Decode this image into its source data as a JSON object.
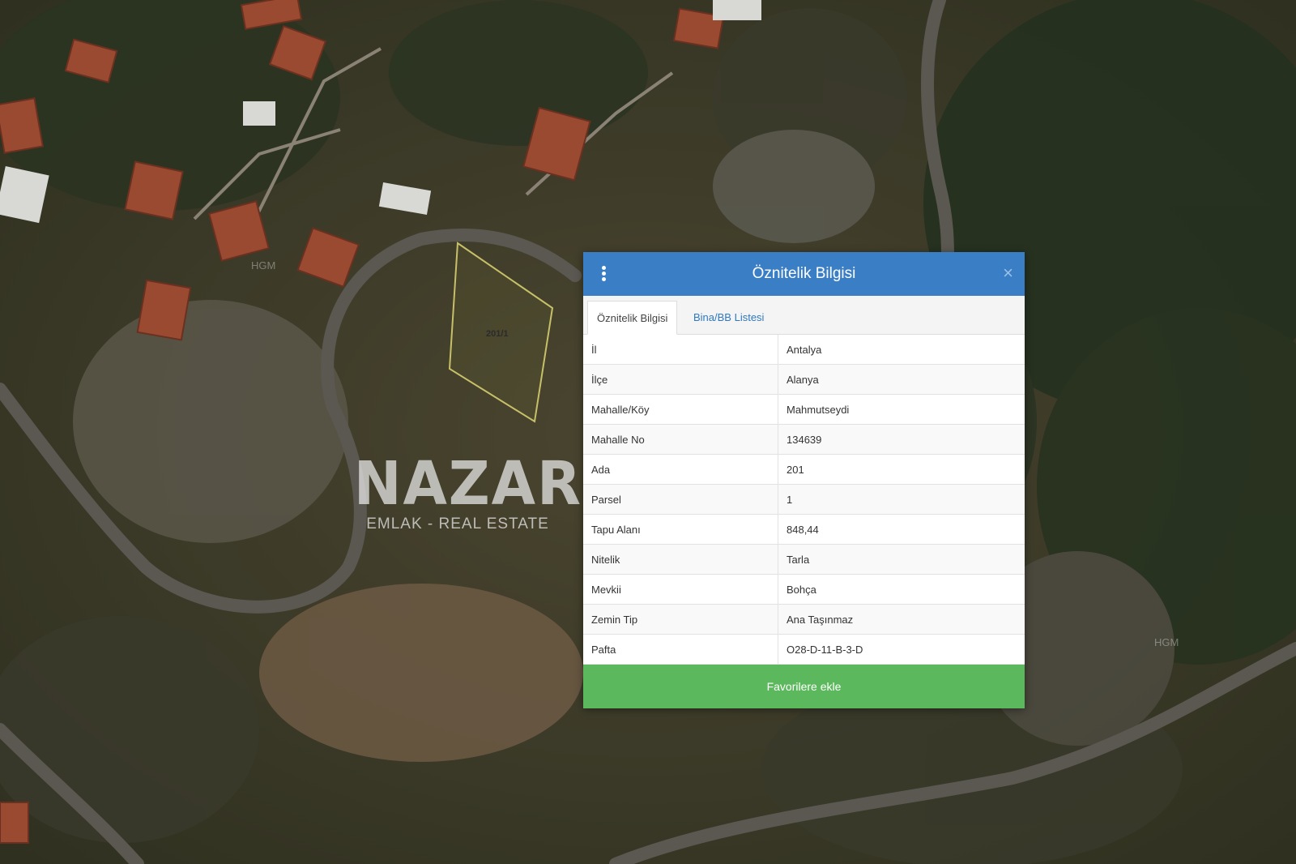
{
  "map": {
    "parcel_label": "201/1",
    "hgm_label_1": "HGM",
    "hgm_label_2": "HGM"
  },
  "watermark": {
    "main": "NAZAR",
    "sub": "EMLAK - REAL ESTATE"
  },
  "dialog": {
    "title": "Öznitelik Bilgisi",
    "menu_icon": "vertical-dots-icon",
    "close_icon": "close-icon",
    "close_glyph": "×",
    "tabs": [
      {
        "label": "Öznitelik Bilgisi",
        "active": true
      },
      {
        "label": "Bina/BB Listesi",
        "active": false
      }
    ],
    "rows": [
      {
        "key": "İl",
        "value": "Antalya"
      },
      {
        "key": "İlçe",
        "value": "Alanya"
      },
      {
        "key": "Mahalle/Köy",
        "value": "Mahmutseydi"
      },
      {
        "key": "Mahalle No",
        "value": "134639"
      },
      {
        "key": "Ada",
        "value": "201"
      },
      {
        "key": "Parsel",
        "value": "1"
      },
      {
        "key": "Tapu Alanı",
        "value": "848,44"
      },
      {
        "key": "Nitelik",
        "value": "Tarla"
      },
      {
        "key": "Mevkii",
        "value": "Bohça"
      },
      {
        "key": "Zemin Tip",
        "value": "Ana Taşınmaz"
      },
      {
        "key": "Pafta",
        "value": "O28-D-11-B-3-D"
      }
    ],
    "favorite_button": "Favorilere ekle"
  },
  "colors": {
    "header": "#3a7ec6",
    "favorite": "#5cb85c",
    "tab_link": "#2f79c0",
    "parcel_outline": "#c8c068"
  }
}
